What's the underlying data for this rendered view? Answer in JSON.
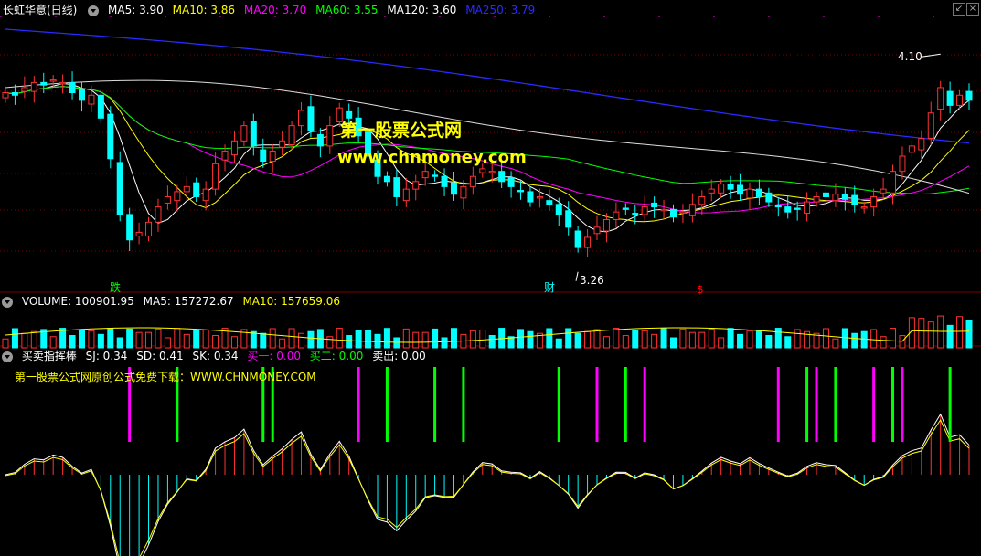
{
  "main": {
    "stock_title": "长虹华意(日线)",
    "ma": [
      {
        "label": "MA5: 3.90",
        "color": "#ffffff"
      },
      {
        "label": "MA10: 3.86",
        "color": "#ffff00"
      },
      {
        "label": "MA20: 3.70",
        "color": "#ff00ff"
      },
      {
        "label": "MA60: 3.55",
        "color": "#00ff00"
      },
      {
        "label": "MA120: 3.60",
        "color": "#ffffff"
      },
      {
        "label": "MA250: 3.79",
        "color": "#0000ff"
      }
    ],
    "high_label": "4.10",
    "low_label": "3.26",
    "signal_die": "跌",
    "signal_cai": "财",
    "signal_dollar": "$",
    "watermark_title": "第一股票公式网",
    "watermark_url": "www.chnmoney.com",
    "colors": {
      "up": "#ff3232",
      "down": "#00ffff",
      "grid": "#800000"
    }
  },
  "volume": {
    "title": "VOLUME: 100901.95",
    "ma5": "MA5: 157272.67",
    "ma10": "MA10: 157659.06"
  },
  "indicator": {
    "title": "买卖指挥棒",
    "sj": "SJ: 0.34",
    "sd": "SD: 0.41",
    "sk": "SK: 0.34",
    "buy1": "买一: 0.00",
    "buy2": "买二: 0.00",
    "sell": "卖出: 0.00",
    "note": "第一股票公式网原创公式免费下载：WWW.CHNMONEY.COM"
  },
  "chart_data": {
    "type": "candlestick",
    "title": "长虹华意(日线)",
    "y_range": [
      3.26,
      4.1
    ],
    "max_price": 4.1,
    "min_price": 3.26,
    "moving_averages": {
      "MA5": 3.9,
      "MA10": 3.86,
      "MA20": 3.7,
      "MA60": 3.55,
      "MA120": 3.6,
      "MA250": 3.79
    },
    "volume": {
      "VOLUME": 100901.95,
      "MA5": 157272.67,
      "MA10": 157659.06
    },
    "indicator": {
      "SJ": 0.34,
      "SD": 0.41,
      "SK": 0.34,
      "买一": 0.0,
      "买二": 0.0,
      "卖出": 0.0
    },
    "closes": [
      3.93,
      3.92,
      3.95,
      3.97,
      3.96,
      3.98,
      3.97,
      3.93,
      3.9,
      3.92,
      3.83,
      3.67,
      3.45,
      3.35,
      3.38,
      3.42,
      3.48,
      3.52,
      3.54,
      3.56,
      3.52,
      3.55,
      3.65,
      3.7,
      3.74,
      3.8,
      3.72,
      3.66,
      3.7,
      3.74,
      3.8,
      3.86,
      3.78,
      3.72,
      3.8,
      3.87,
      3.83,
      3.76,
      3.68,
      3.6,
      3.58,
      3.52,
      3.55,
      3.58,
      3.62,
      3.6,
      3.56,
      3.53,
      3.56,
      3.6,
      3.63,
      3.62,
      3.58,
      3.56,
      3.54,
      3.5,
      3.52,
      3.49,
      3.45,
      3.4,
      3.32,
      3.36,
      3.4,
      3.43,
      3.46,
      3.47,
      3.45,
      3.48,
      3.48,
      3.47,
      3.44,
      3.46,
      3.49,
      3.52,
      3.55,
      3.57,
      3.55,
      3.53,
      3.55,
      3.52,
      3.5,
      3.48,
      3.46,
      3.47,
      3.5,
      3.52,
      3.52,
      3.53,
      3.51,
      3.49,
      3.48,
      3.52,
      3.55,
      3.62,
      3.68,
      3.72,
      3.75,
      3.85,
      3.95,
      3.88,
      3.92,
      3.9
    ]
  }
}
